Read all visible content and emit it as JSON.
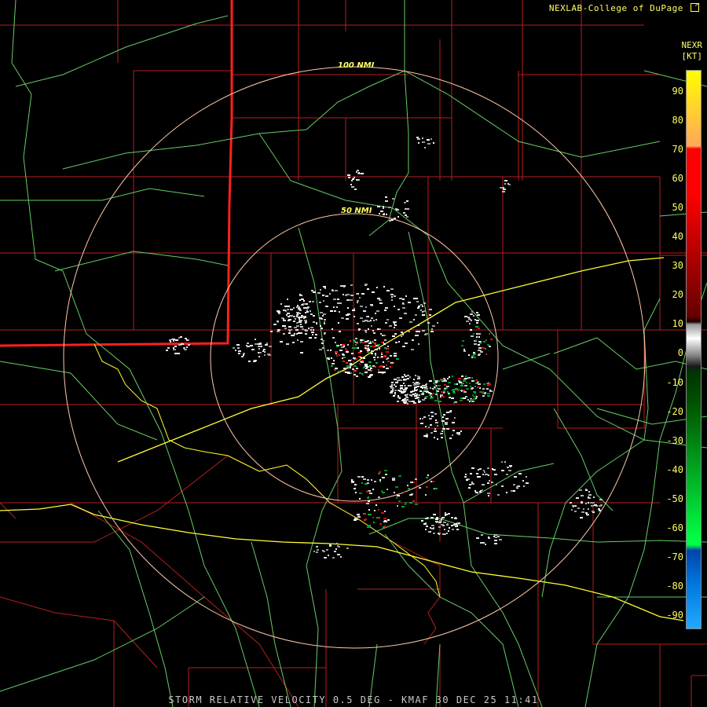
{
  "header": {
    "credit": "NEXLAB-College of DuPage",
    "credit_icon": "external-link-icon"
  },
  "legend": {
    "product": "NEXR",
    "units": "[KT]",
    "ticks": [
      "90",
      "80",
      "70",
      "60",
      "50",
      "40",
      "30",
      "20",
      "10",
      "0",
      "-10",
      "-20",
      "-30",
      "-40",
      "-50",
      "-60",
      "-70",
      "-80",
      "-90"
    ],
    "colors": {
      "yellow": "#ffff00",
      "orange": "#ffaa55",
      "red": "#ff0000",
      "dark_red": "#660000",
      "gray": "#ffffff",
      "dark_green": "#005500",
      "green": "#00ff44",
      "blue": "#0077dd",
      "light_blue": "#22aaff"
    }
  },
  "map": {
    "rings": [
      {
        "label": "100 NMI"
      },
      {
        "label": "50 NMI"
      }
    ],
    "colors": {
      "county_lines": "#b81e1e",
      "state_line": "#ff2020",
      "highways": "#66cc66",
      "interstates": "#ffff33",
      "rings": "#ffc8a8",
      "border": "#ffff33"
    }
  },
  "footer": {
    "caption": "STORM RELATIVE VELOCITY 0.5 DEG - KMAF 30 DEC 25 11:41"
  }
}
